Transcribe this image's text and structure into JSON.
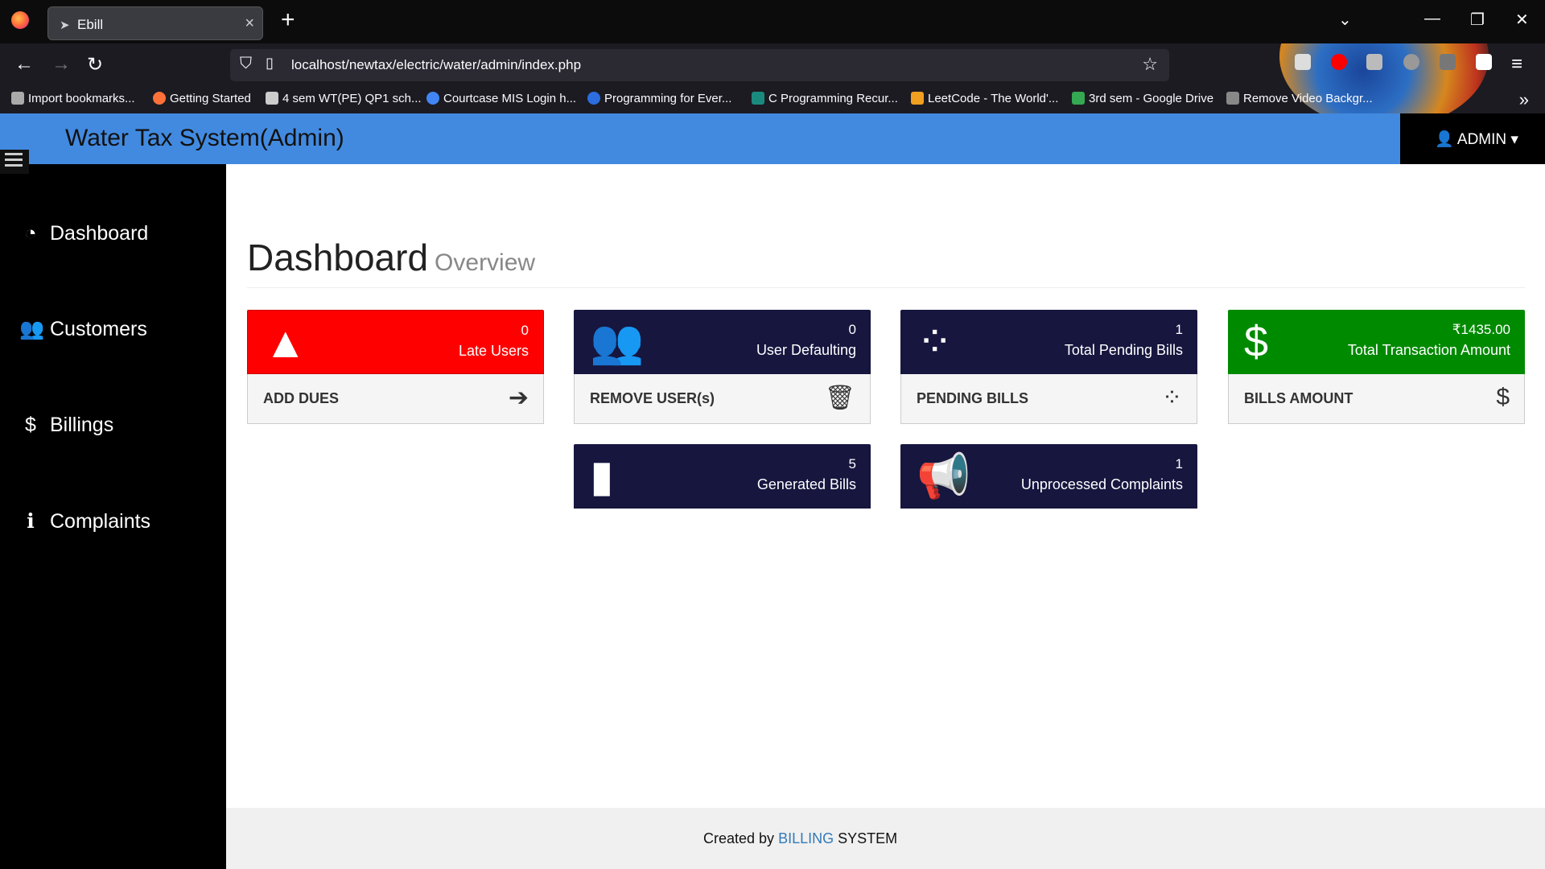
{
  "browser": {
    "tab_title": "Ebill",
    "tab_close": "×",
    "new_tab": "+",
    "url": "localhost/newtax/electric/water/admin/index.php",
    "bookmarks": [
      "Import bookmarks...",
      "Getting Started",
      "4 sem WT(PE) QP1 sch...",
      "Courtcase MIS Login h...",
      "Programming for Ever...",
      "C Programming Recur...",
      "LeetCode - The World'...",
      "3rd sem - Google Drive",
      "Remove Video Backgr..."
    ]
  },
  "header": {
    "title": "Water Tax System(Admin)",
    "user_menu": "ADMIN"
  },
  "sidebar": {
    "items": [
      {
        "label": "Dashboard",
        "icon": "dashboard-icon"
      },
      {
        "label": "Customers",
        "icon": "users-icon"
      },
      {
        "label": "Billings",
        "icon": "dollar-icon"
      },
      {
        "label": "Complaints",
        "icon": "info-icon"
      }
    ]
  },
  "page": {
    "title": "Dashboard",
    "subtitle": "Overview"
  },
  "cards": [
    {
      "value": "0",
      "label": "Late Users",
      "action": "ADD DUES",
      "color": "#fe0000"
    },
    {
      "value": "0",
      "label": "User Defaulting",
      "action": "REMOVE USER(s)",
      "color": "#16163f"
    },
    {
      "value": "1",
      "label": "Total Pending Bills",
      "action": "PENDING BILLS",
      "color": "#16163f"
    },
    {
      "value": "₹1435.00",
      "label": "Total Transaction Amount",
      "action": "BILLS AMOUNT",
      "color": "#008a00"
    },
    {
      "value": "5",
      "label": "Generated Bills",
      "color": "#16163f"
    },
    {
      "value": "1",
      "label": "Unprocessed Complaints",
      "color": "#16163f"
    }
  ],
  "footer": {
    "prefix": "Created by",
    "link": "BILLING",
    "suffix": "SYSTEM"
  },
  "colors": {
    "header": "#428ae0",
    "sidebar": "#000000",
    "danger": "#fe0000",
    "navy": "#16163f",
    "success": "#008a00"
  }
}
